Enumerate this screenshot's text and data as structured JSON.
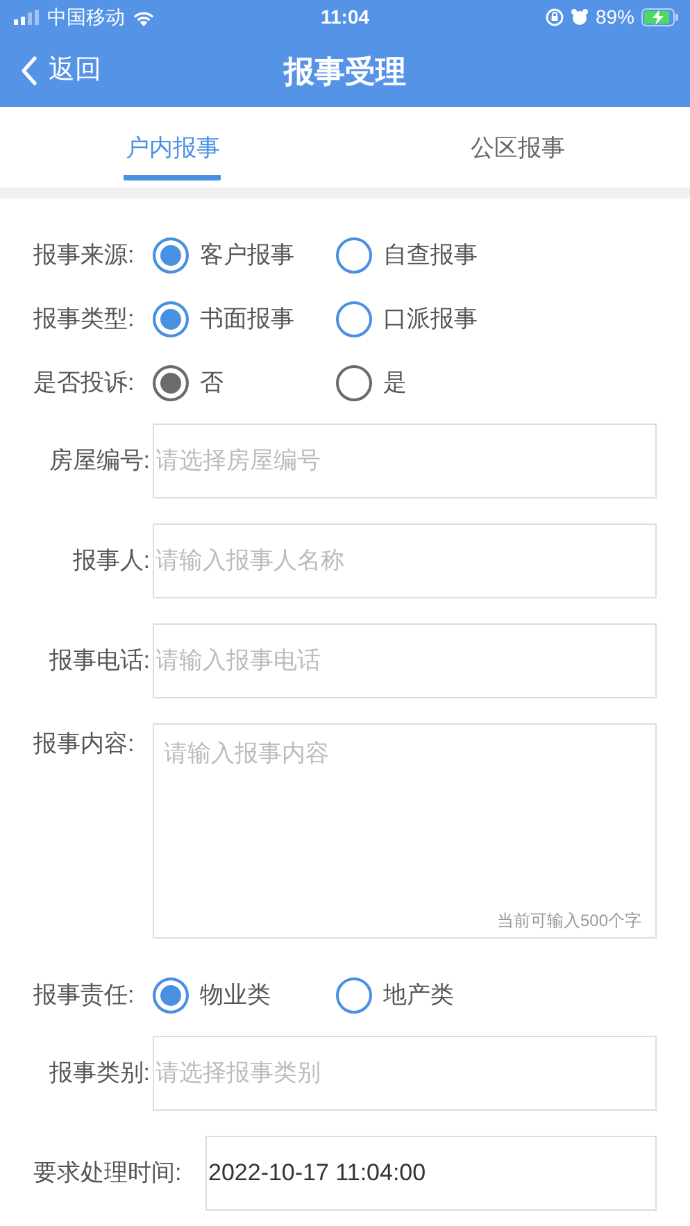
{
  "status_bar": {
    "carrier": "中国移动",
    "time": "11:04",
    "battery": "89%"
  },
  "nav": {
    "back": "返回",
    "title": "报事受理"
  },
  "tabs": [
    {
      "label": "户内报事",
      "selected": true
    },
    {
      "label": "公区报事",
      "selected": false
    }
  ],
  "form": [
    {
      "kind": "radio",
      "label": "报事来源:",
      "color": "#4a90e2",
      "options": [
        {
          "label": "客户报事",
          "selected": true
        },
        {
          "label": "自查报事",
          "selected": false
        }
      ]
    },
    {
      "kind": "radio",
      "label": "报事类型:",
      "color": "#4a90e2",
      "options": [
        {
          "label": "书面报事",
          "selected": true
        },
        {
          "label": "口派报事",
          "selected": false
        }
      ]
    },
    {
      "kind": "radio",
      "label": "是否投诉:",
      "color": "#6b6b6b",
      "options": [
        {
          "label": "否",
          "selected": true
        },
        {
          "label": "是",
          "selected": false
        }
      ]
    },
    {
      "kind": "field",
      "label": "房屋编号:",
      "placeholder": "请选择房屋编号"
    },
    {
      "kind": "field",
      "label": "报事人:",
      "placeholder": "请输入报事人名称"
    },
    {
      "kind": "field",
      "label": "报事电话:",
      "placeholder": "请输入报事电话"
    },
    {
      "kind": "textarea",
      "label": "报事内容:",
      "placeholder": "请输入报事内容",
      "counter": "当前可输入500个字"
    },
    {
      "kind": "radio",
      "label": "报事责任:",
      "color": "#4a90e2",
      "options": [
        {
          "label": "物业类",
          "selected": true
        },
        {
          "label": "地产类",
          "selected": false
        }
      ]
    },
    {
      "kind": "field",
      "label": "报事类别:",
      "placeholder": "请选择报事类别"
    },
    {
      "kind": "wide_field",
      "label": "要求处理时间:",
      "value": "2022-10-17 11:04:00"
    }
  ]
}
